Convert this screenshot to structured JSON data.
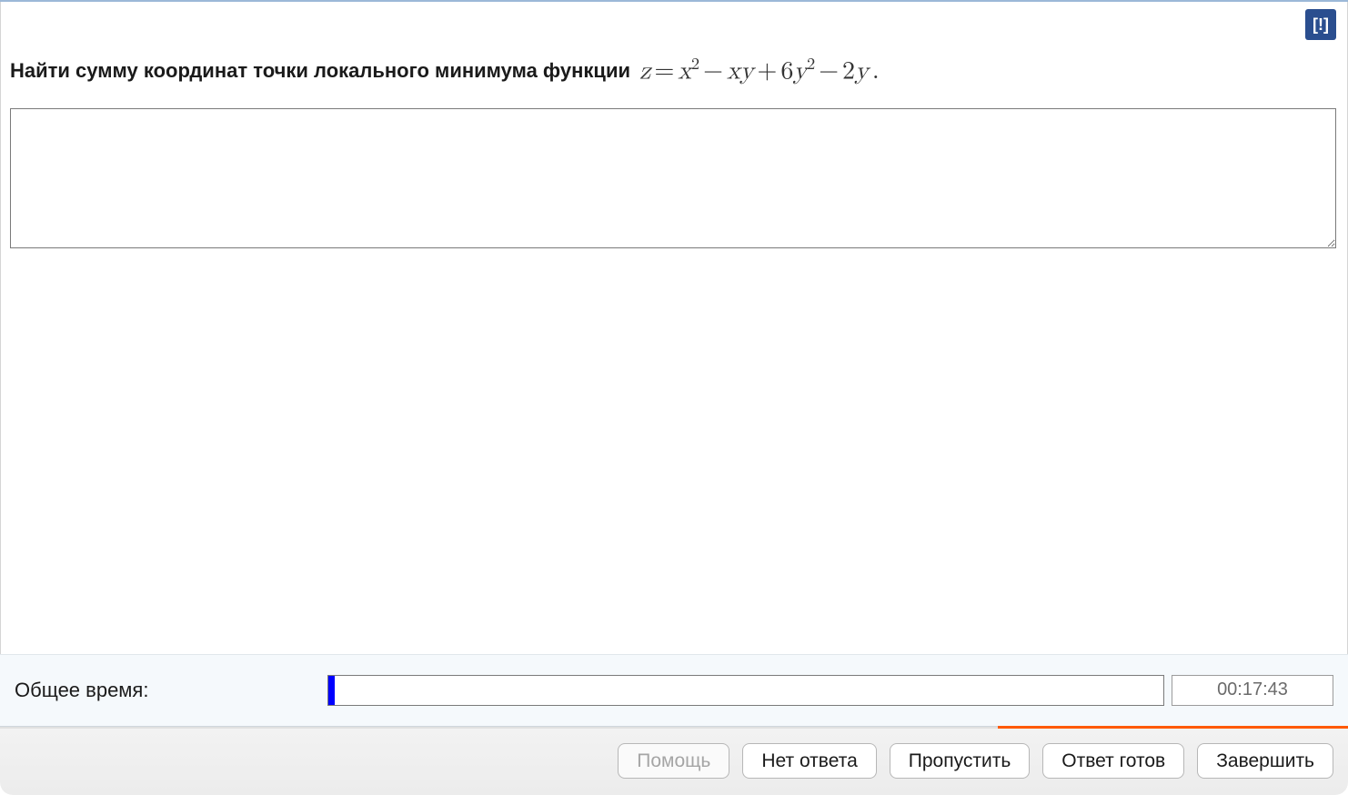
{
  "alert": {
    "label": "[!]"
  },
  "question": {
    "prompt": "Найти сумму координат точки локального минимума функции",
    "formula_plain": "z = x^2 − xy + 6y^2 − 2y ."
  },
  "answer": {
    "value": "",
    "placeholder": ""
  },
  "timer": {
    "label": "Общее время:",
    "elapsed_display": "00:17:43",
    "progress_percent": 0.8
  },
  "buttons": {
    "help": "Помощь",
    "no_answer": "Нет ответа",
    "skip": "Пропустить",
    "answer_ready": "Ответ готов",
    "finish": "Завершить"
  }
}
